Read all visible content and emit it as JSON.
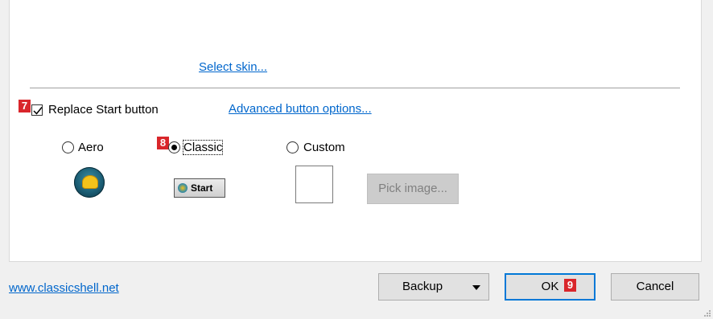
{
  "skin": {
    "select_link": "Select skin..."
  },
  "start_button": {
    "replace_label": "Replace Start button",
    "replace_checked": true,
    "advanced_link": "Advanced button options...",
    "options": [
      {
        "label": "Aero",
        "selected": false
      },
      {
        "label": "Classic",
        "selected": true
      },
      {
        "label": "Custom",
        "selected": false
      }
    ],
    "classic_preview_text": "Start",
    "pick_image_label": "Pick image..."
  },
  "badges": {
    "b7": "7",
    "b8": "8",
    "b9": "9"
  },
  "footer": {
    "website_link": "www.classicshell.net",
    "backup_label": "Backup",
    "ok_label": "OK",
    "cancel_label": "Cancel"
  },
  "colors": {
    "link": "#0066cc",
    "badge": "#d9262b",
    "default_button_border": "#0078d7"
  },
  "icons": [
    "check-icon",
    "shell-orb-icon",
    "dropdown-arrow-icon",
    "resize-grip-icon"
  ]
}
